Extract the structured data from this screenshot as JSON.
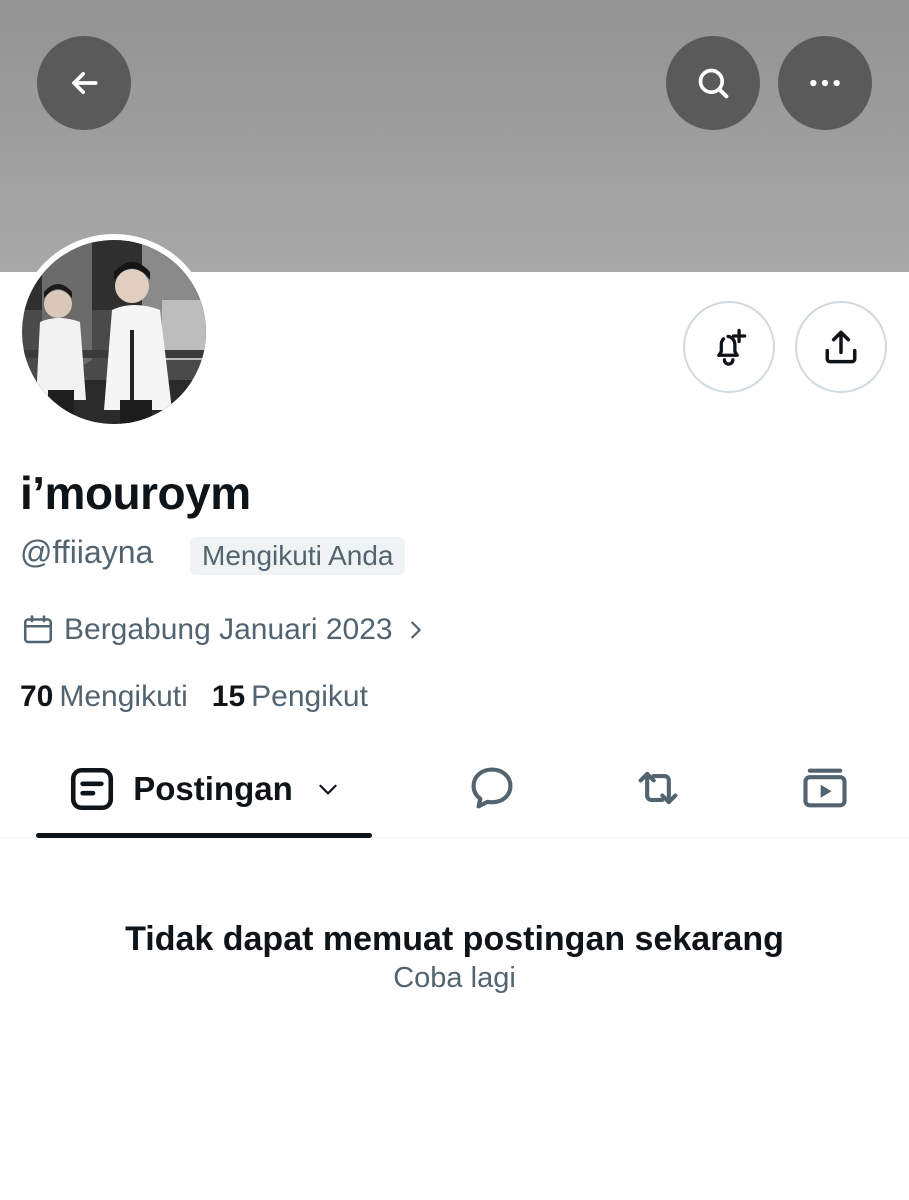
{
  "profile": {
    "display_name": "i’mouroym",
    "handle": "@ffiiayna",
    "follows_you": "Mengikuti Anda",
    "joined": "Bergabung Januari 2023",
    "following_count": "70",
    "following_label": "Mengikuti",
    "followers_count": "15",
    "followers_label": "Pengikut"
  },
  "tabs": {
    "active_label": "Postingan",
    "icons": [
      "posts-doc-icon",
      "replies-bubble-icon",
      "retweet-icon",
      "video-media-icon"
    ]
  },
  "empty_state": {
    "title": "Tidak dapat memuat postingan sekarang",
    "retry": "Coba lagi"
  },
  "icons": {
    "top_bar": [
      "back-arrow-icon",
      "search-icon",
      "more-dots-icon"
    ],
    "actions": [
      "notification-bell-plus-icon",
      "share-upload-icon"
    ]
  },
  "colors": {
    "banner": "#a0a0a0",
    "overlay_button": "#5a5a5a",
    "text_primary": "#0f1419",
    "text_secondary": "#536471",
    "border": "#cfd9de",
    "badge_bg": "#eff3f4"
  }
}
